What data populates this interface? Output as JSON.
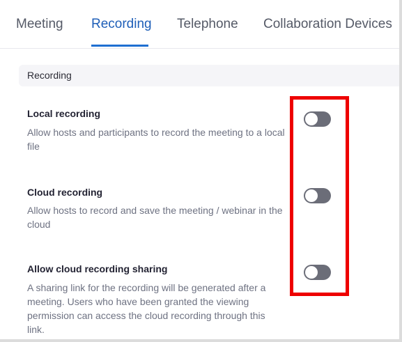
{
  "tabs": [
    {
      "label": "Meeting"
    },
    {
      "label": "Recording"
    },
    {
      "label": "Telephone"
    },
    {
      "label": "Collaboration Devices"
    }
  ],
  "active_tab": "Recording",
  "section": {
    "title": "Recording"
  },
  "settings": [
    {
      "title": "Local recording",
      "description": "Allow hosts and participants to record the meeting to a local file",
      "enabled": false
    },
    {
      "title": "Cloud recording",
      "description": "Allow hosts to record and save the meeting / webinar in the cloud",
      "enabled": false
    },
    {
      "title": "Allow cloud recording sharing",
      "description": "A sharing link for the recording will be generated after a meeting. Users who have been granted the viewing permission can access the cloud recording through this link.",
      "enabled": false
    }
  ],
  "colors": {
    "accent": "#1f6fd1",
    "toggle_off": "#6b6d78",
    "highlight": "#ee0000"
  }
}
